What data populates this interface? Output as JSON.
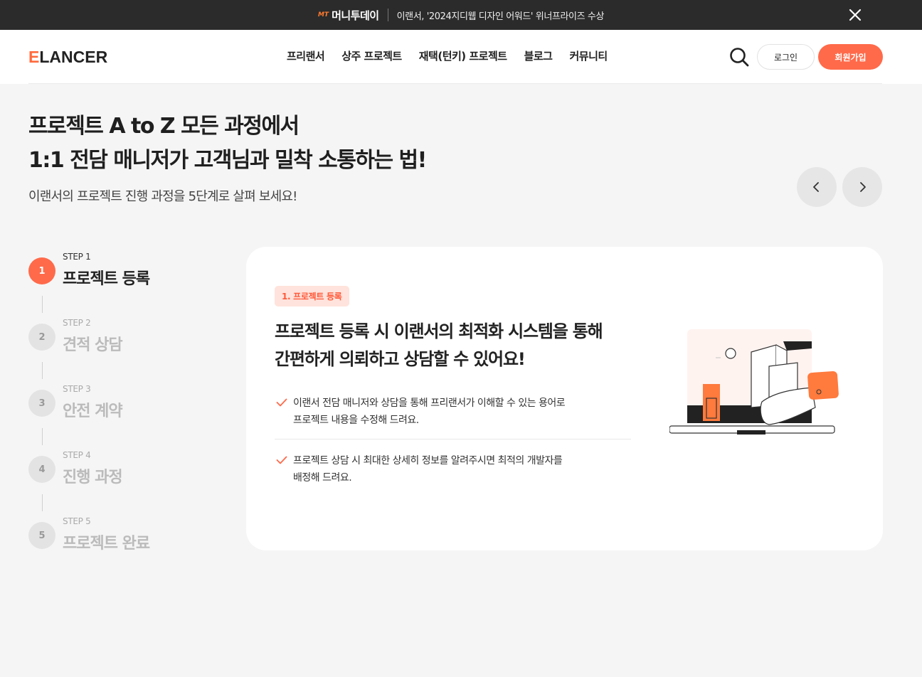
{
  "banner": {
    "logo_mark": "MT",
    "brand": "머니투데이",
    "text": "이랜서, '2024지디웹 디자인 어워드' 위너프라이즈 수상"
  },
  "header": {
    "logo_prefix": "E",
    "logo_text": "LANCER",
    "nav": [
      "프리랜서",
      "상주 프로젝트",
      "재택(턴키) 프로젝트",
      "블로그",
      "커뮤니티"
    ],
    "login_label": "로그인",
    "signup_label": "회원가입"
  },
  "hero": {
    "title_line1": "프로젝트 A to Z 모든 과정에서",
    "title_line2": "1:1 전담 매니저가 고객님과 밀착 소통하는 법!",
    "subtitle": "이랜서의 프로젝트 진행 과정을 5단계로 살펴 보세요!"
  },
  "steps": [
    {
      "num": "1",
      "step": "STEP 1",
      "label": "프로젝트 등록",
      "active": true
    },
    {
      "num": "2",
      "step": "STEP 2",
      "label": "견적 상담",
      "active": false
    },
    {
      "num": "3",
      "step": "STEP 3",
      "label": "안전 계약",
      "active": false
    },
    {
      "num": "4",
      "step": "STEP 4",
      "label": "진행 과정",
      "active": false
    },
    {
      "num": "5",
      "step": "STEP 5",
      "label": "프로젝트 완료",
      "active": false
    }
  ],
  "card": {
    "tag": "1. 프로젝트 등록",
    "title_line1": "프로젝트 등록 시 이랜서의 최적화 시스템을 통해",
    "title_line2": "간편하게 의뢰하고 상담할 수 있어요!",
    "items": [
      {
        "line1": "이랜서 전담 매니저와 상담을 통해 프리랜서가 이해할 수 있는 용어로",
        "line2": "프로젝트 내용을 수정해 드려요."
      },
      {
        "line1": "프로젝트 상담 시 최대한 상세히 정보를 알려주시면 최적의 개발자를",
        "line2": "배정해 드려요."
      }
    ]
  },
  "colors": {
    "accent": "#ff6a4a",
    "banner_bg": "#2b2b2b",
    "tag_bg": "#ffe3dc"
  }
}
